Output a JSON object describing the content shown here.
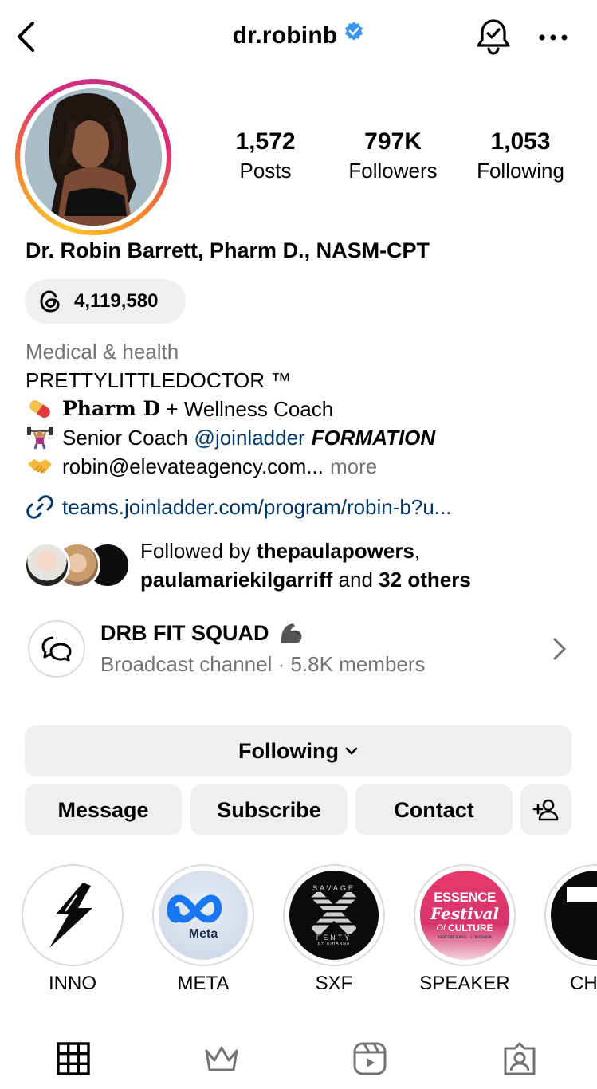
{
  "header": {
    "username": "dr.robinb",
    "verified": true
  },
  "profile": {
    "stats": [
      {
        "value": "1,572",
        "label": "Posts"
      },
      {
        "value": "797K",
        "label": "Followers"
      },
      {
        "value": "1,053",
        "label": "Following"
      }
    ],
    "full_name": "Dr. Robin Barrett, Pharm D., NASM-CPT",
    "threads_count": "4,119,580",
    "category": "Medical & health",
    "bio": {
      "line1": "PRETTYLITTLEDOCTOR ™",
      "line2_bold": "𝐏𝐡𝐚𝐫𝐦 𝐃",
      "line2_rest": "+ Wellness Coach",
      "line3_text": "Senior Coach",
      "line3_mention": "@joinladder",
      "line3_bold": "FORMATION",
      "line4_text": "robin@elevateagency.com...",
      "line4_more": "more"
    },
    "link": "teams.joinladder.com/program/robin-b?u...",
    "followed_by": {
      "prefix": "Followed by",
      "user1": "thepaulapowers",
      "sep": ",",
      "user2": "paulamariekilgarriff",
      "and": "and",
      "others": "32 others"
    }
  },
  "channel": {
    "name": "DRB FIT SQUAD",
    "subtitle": "Broadcast channel · 5.8K members"
  },
  "buttons": {
    "following": "Following",
    "message": "Message",
    "subscribe": "Subscribe",
    "contact": "Contact"
  },
  "highlights": [
    {
      "label": "INNO"
    },
    {
      "label": "META",
      "logo_text": "Meta"
    },
    {
      "label": "SXF",
      "logo_top": "SAVAGE",
      "logo_bottom": "FENTY",
      "logo_sub": "BY RIHANNA"
    },
    {
      "label": "SPEAKER",
      "logo_top": "ESSENCE",
      "logo_mid": "Festival",
      "logo_of": "Of",
      "logo_culture": "CULTURE",
      "logo_sub": "NEW ORLEANS · LOUISIANA"
    },
    {
      "label": "CH"
    }
  ],
  "tabs": [
    "grid-icon",
    "crown-icon",
    "reels-icon",
    "tagged-icon"
  ],
  "colors": {
    "link": "#00376b",
    "secondary_text": "#737373",
    "button_bg": "#efefef",
    "verified": "#3897f0"
  }
}
